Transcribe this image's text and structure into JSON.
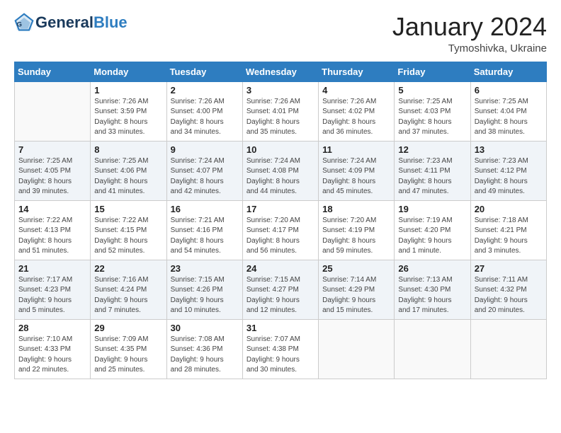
{
  "header": {
    "logo_general": "General",
    "logo_blue": "Blue",
    "month_title": "January 2024",
    "subtitle": "Tymoshivka, Ukraine"
  },
  "days_of_week": [
    "Sunday",
    "Monday",
    "Tuesday",
    "Wednesday",
    "Thursday",
    "Friday",
    "Saturday"
  ],
  "weeks": [
    [
      {
        "day": "",
        "info": ""
      },
      {
        "day": "1",
        "info": "Sunrise: 7:26 AM\nSunset: 3:59 PM\nDaylight: 8 hours\nand 33 minutes."
      },
      {
        "day": "2",
        "info": "Sunrise: 7:26 AM\nSunset: 4:00 PM\nDaylight: 8 hours\nand 34 minutes."
      },
      {
        "day": "3",
        "info": "Sunrise: 7:26 AM\nSunset: 4:01 PM\nDaylight: 8 hours\nand 35 minutes."
      },
      {
        "day": "4",
        "info": "Sunrise: 7:26 AM\nSunset: 4:02 PM\nDaylight: 8 hours\nand 36 minutes."
      },
      {
        "day": "5",
        "info": "Sunrise: 7:25 AM\nSunset: 4:03 PM\nDaylight: 8 hours\nand 37 minutes."
      },
      {
        "day": "6",
        "info": "Sunrise: 7:25 AM\nSunset: 4:04 PM\nDaylight: 8 hours\nand 38 minutes."
      }
    ],
    [
      {
        "day": "7",
        "info": "Sunrise: 7:25 AM\nSunset: 4:05 PM\nDaylight: 8 hours\nand 39 minutes."
      },
      {
        "day": "8",
        "info": "Sunrise: 7:25 AM\nSunset: 4:06 PM\nDaylight: 8 hours\nand 41 minutes."
      },
      {
        "day": "9",
        "info": "Sunrise: 7:24 AM\nSunset: 4:07 PM\nDaylight: 8 hours\nand 42 minutes."
      },
      {
        "day": "10",
        "info": "Sunrise: 7:24 AM\nSunset: 4:08 PM\nDaylight: 8 hours\nand 44 minutes."
      },
      {
        "day": "11",
        "info": "Sunrise: 7:24 AM\nSunset: 4:09 PM\nDaylight: 8 hours\nand 45 minutes."
      },
      {
        "day": "12",
        "info": "Sunrise: 7:23 AM\nSunset: 4:11 PM\nDaylight: 8 hours\nand 47 minutes."
      },
      {
        "day": "13",
        "info": "Sunrise: 7:23 AM\nSunset: 4:12 PM\nDaylight: 8 hours\nand 49 minutes."
      }
    ],
    [
      {
        "day": "14",
        "info": "Sunrise: 7:22 AM\nSunset: 4:13 PM\nDaylight: 8 hours\nand 51 minutes."
      },
      {
        "day": "15",
        "info": "Sunrise: 7:22 AM\nSunset: 4:15 PM\nDaylight: 8 hours\nand 52 minutes."
      },
      {
        "day": "16",
        "info": "Sunrise: 7:21 AM\nSunset: 4:16 PM\nDaylight: 8 hours\nand 54 minutes."
      },
      {
        "day": "17",
        "info": "Sunrise: 7:20 AM\nSunset: 4:17 PM\nDaylight: 8 hours\nand 56 minutes."
      },
      {
        "day": "18",
        "info": "Sunrise: 7:20 AM\nSunset: 4:19 PM\nDaylight: 8 hours\nand 59 minutes."
      },
      {
        "day": "19",
        "info": "Sunrise: 7:19 AM\nSunset: 4:20 PM\nDaylight: 9 hours\nand 1 minute."
      },
      {
        "day": "20",
        "info": "Sunrise: 7:18 AM\nSunset: 4:21 PM\nDaylight: 9 hours\nand 3 minutes."
      }
    ],
    [
      {
        "day": "21",
        "info": "Sunrise: 7:17 AM\nSunset: 4:23 PM\nDaylight: 9 hours\nand 5 minutes."
      },
      {
        "day": "22",
        "info": "Sunrise: 7:16 AM\nSunset: 4:24 PM\nDaylight: 9 hours\nand 7 minutes."
      },
      {
        "day": "23",
        "info": "Sunrise: 7:15 AM\nSunset: 4:26 PM\nDaylight: 9 hours\nand 10 minutes."
      },
      {
        "day": "24",
        "info": "Sunrise: 7:15 AM\nSunset: 4:27 PM\nDaylight: 9 hours\nand 12 minutes."
      },
      {
        "day": "25",
        "info": "Sunrise: 7:14 AM\nSunset: 4:29 PM\nDaylight: 9 hours\nand 15 minutes."
      },
      {
        "day": "26",
        "info": "Sunrise: 7:13 AM\nSunset: 4:30 PM\nDaylight: 9 hours\nand 17 minutes."
      },
      {
        "day": "27",
        "info": "Sunrise: 7:11 AM\nSunset: 4:32 PM\nDaylight: 9 hours\nand 20 minutes."
      }
    ],
    [
      {
        "day": "28",
        "info": "Sunrise: 7:10 AM\nSunset: 4:33 PM\nDaylight: 9 hours\nand 22 minutes."
      },
      {
        "day": "29",
        "info": "Sunrise: 7:09 AM\nSunset: 4:35 PM\nDaylight: 9 hours\nand 25 minutes."
      },
      {
        "day": "30",
        "info": "Sunrise: 7:08 AM\nSunset: 4:36 PM\nDaylight: 9 hours\nand 28 minutes."
      },
      {
        "day": "31",
        "info": "Sunrise: 7:07 AM\nSunset: 4:38 PM\nDaylight: 9 hours\nand 30 minutes."
      },
      {
        "day": "",
        "info": ""
      },
      {
        "day": "",
        "info": ""
      },
      {
        "day": "",
        "info": ""
      }
    ]
  ]
}
